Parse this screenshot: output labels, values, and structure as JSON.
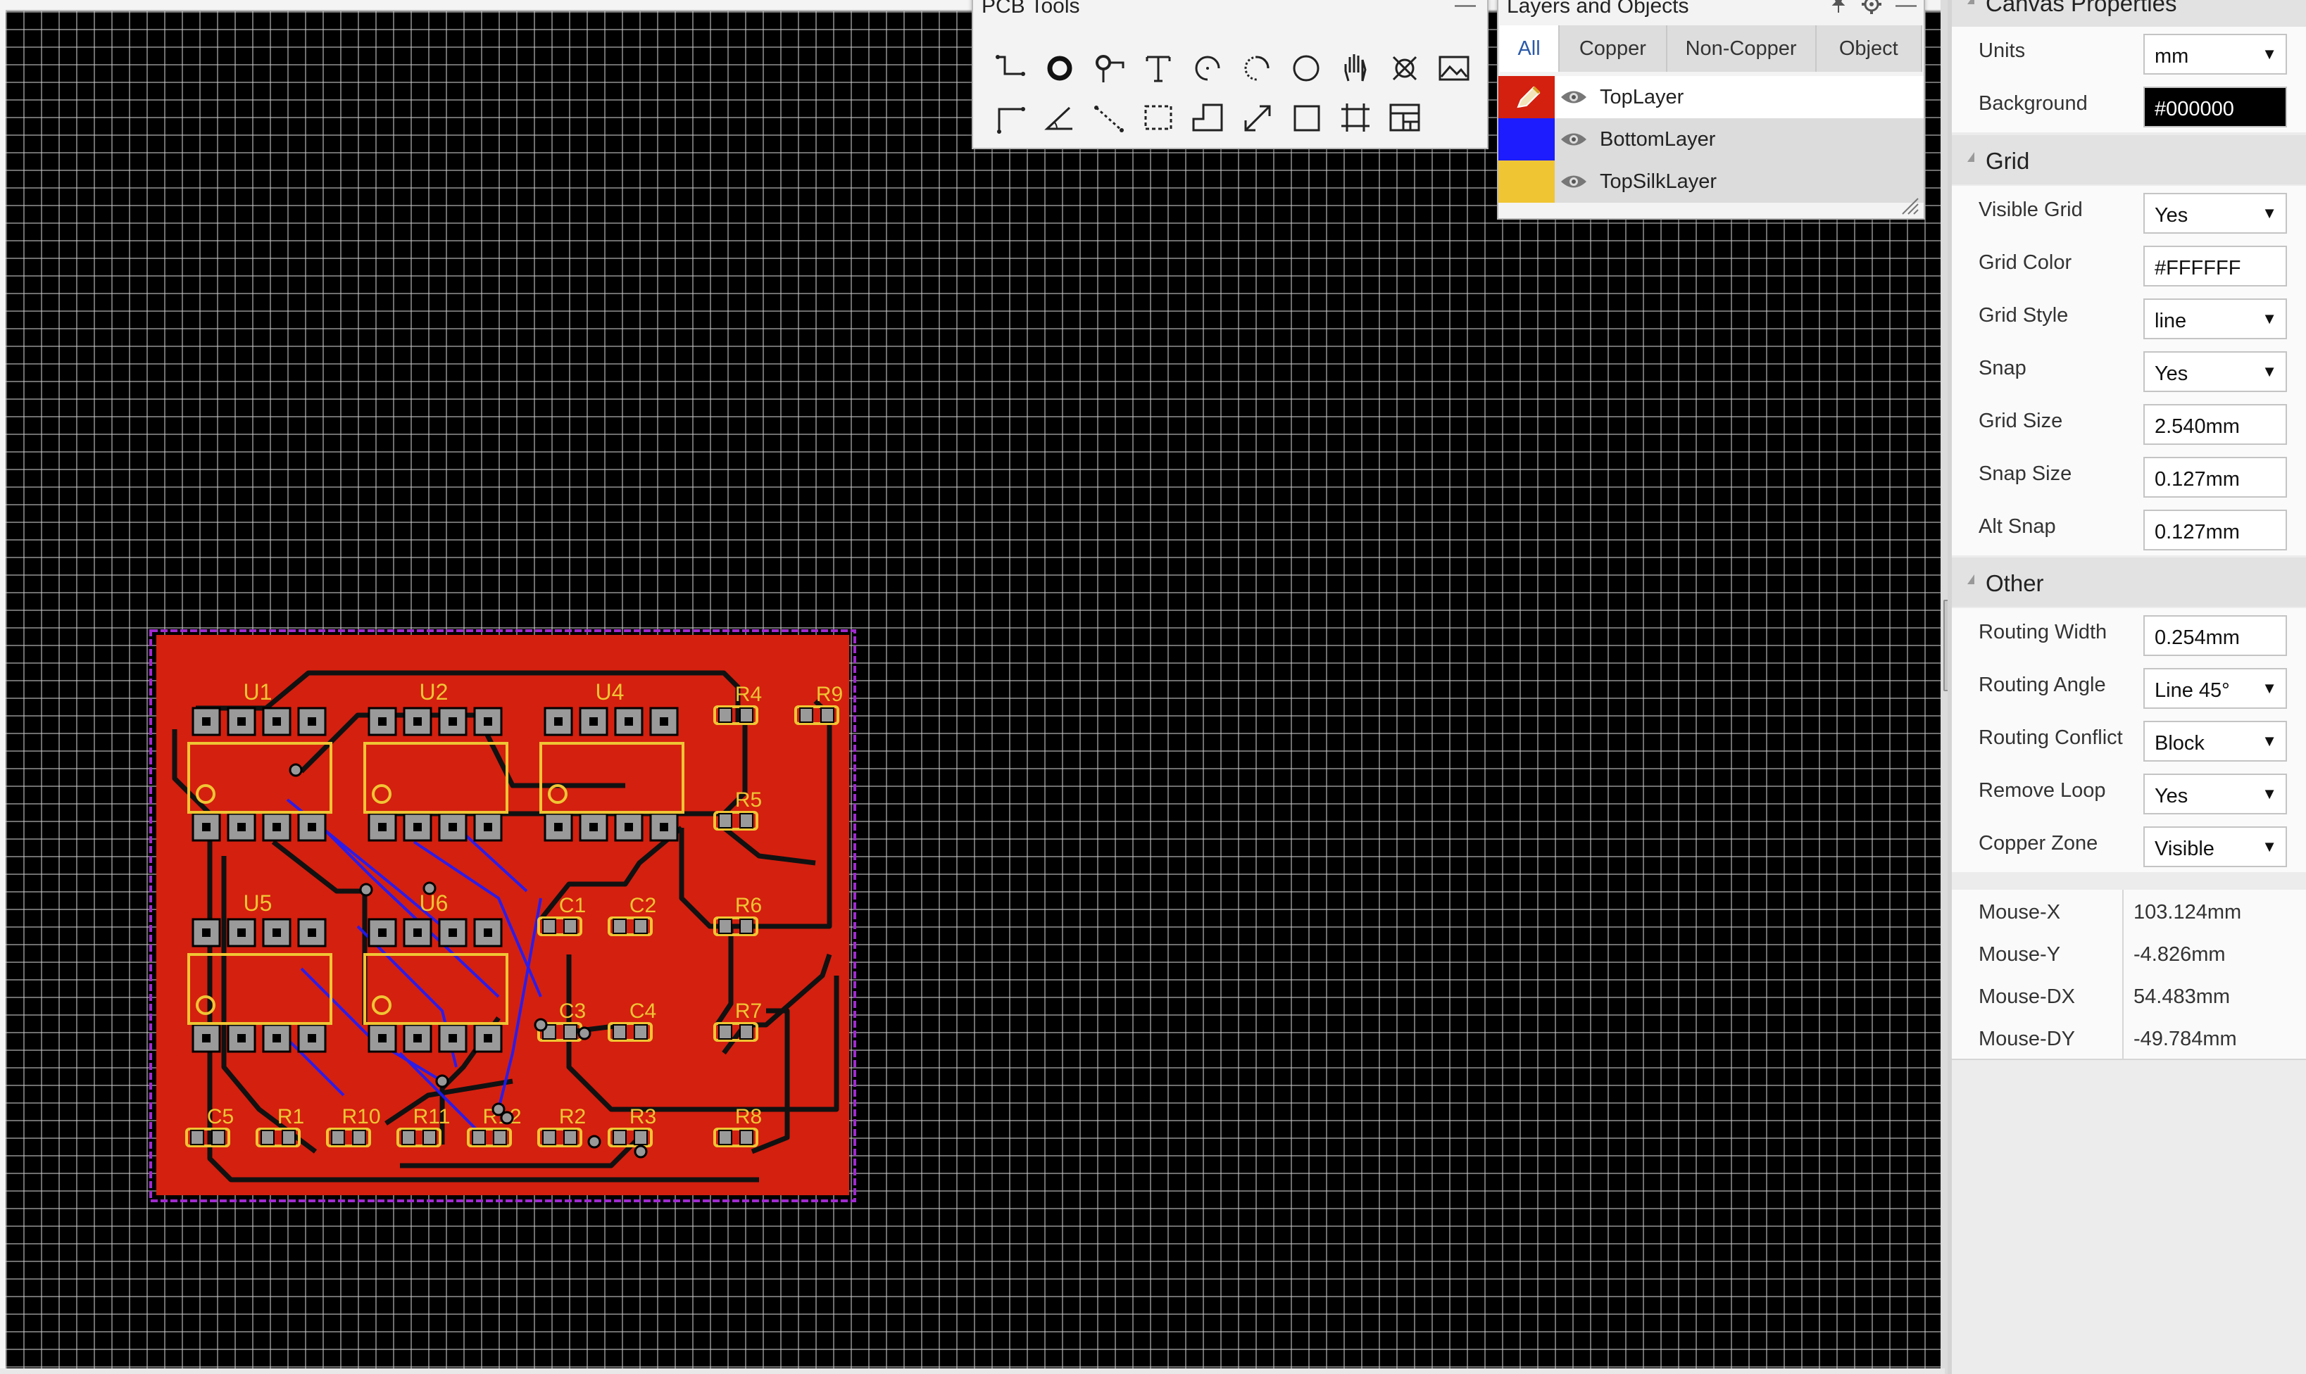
{
  "pcb_tools": {
    "title": "PCB Tools",
    "minimize": "—",
    "tools": [
      "track-icon",
      "pad-icon",
      "via-icon",
      "text-icon",
      "arc-icon",
      "center-arc-icon",
      "circle-icon",
      "pan-hand-icon",
      "cross-circle-icon",
      "image-icon",
      "corner-line-icon",
      "angle-icon",
      "dimension-icon",
      "select-box-icon",
      "copper-zone-icon",
      "measure-icon",
      "rectangle-icon",
      "group-icon",
      "canvas-view-icon"
    ]
  },
  "layers": {
    "title": "Layers and Objects",
    "minimize": "—",
    "tabs": [
      "All",
      "Copper",
      "Non-Copper",
      "Object"
    ],
    "active_tab": "All",
    "rows": [
      {
        "name": "TopLayer",
        "color": "#d4200f",
        "editing": true
      },
      {
        "name": "BottomLayer",
        "color": "#1c1cff",
        "editing": false
      },
      {
        "name": "TopSilkLayer",
        "color": "#f0c534",
        "editing": false
      }
    ]
  },
  "props": {
    "canvas_title": "Canvas Properties",
    "canvas_rows": [
      {
        "label": "Units",
        "value": "mm",
        "type": "select"
      },
      {
        "label": "Background",
        "value": "#000000",
        "type": "color"
      }
    ],
    "grid_title": "Grid",
    "grid_rows": [
      {
        "label": "Visible Grid",
        "value": "Yes",
        "type": "select"
      },
      {
        "label": "Grid Color",
        "value": "#FFFFFF",
        "type": "input"
      },
      {
        "label": "Grid Style",
        "value": "line",
        "type": "select"
      },
      {
        "label": "Snap",
        "value": "Yes",
        "type": "select"
      },
      {
        "label": "Grid Size",
        "value": "2.540mm",
        "type": "input"
      },
      {
        "label": "Snap Size",
        "value": "0.127mm",
        "type": "input"
      },
      {
        "label": "Alt Snap",
        "value": "0.127mm",
        "type": "input"
      }
    ],
    "other_title": "Other",
    "other_rows": [
      {
        "label": "Routing Width",
        "value": "0.254mm",
        "type": "input"
      },
      {
        "label": "Routing Angle",
        "value": "Line 45°",
        "type": "select"
      },
      {
        "label": "Routing Conflict",
        "value": "Block",
        "type": "select"
      },
      {
        "label": "Remove Loop",
        "value": "Yes",
        "type": "select"
      },
      {
        "label": "Copper Zone",
        "value": "Visible",
        "type": "select"
      }
    ],
    "mouse": [
      {
        "label": "Mouse-X",
        "value": "103.124mm"
      },
      {
        "label": "Mouse-Y",
        "value": "-4.826mm"
      },
      {
        "label": "Mouse-DX",
        "value": "54.483mm"
      },
      {
        "label": "Mouse-DY",
        "value": "-49.784mm"
      }
    ]
  },
  "pcb": {
    "colors": {
      "board": "#d4200f",
      "silk": "#f0c534",
      "outline": "#a02ad0",
      "pad": "#9a9a9a",
      "track": "#111111",
      "bottom_track": "#1c1cff"
    },
    "ic_labels": [
      "U1",
      "U2",
      "U4",
      "U5",
      "U6"
    ],
    "part_labels": [
      "R4",
      "R9",
      "R5",
      "R6",
      "C1",
      "C2",
      "C3",
      "C4",
      "R7",
      "C5",
      "R1",
      "R10",
      "R11",
      "R12",
      "R2",
      "R3",
      "R8"
    ]
  }
}
